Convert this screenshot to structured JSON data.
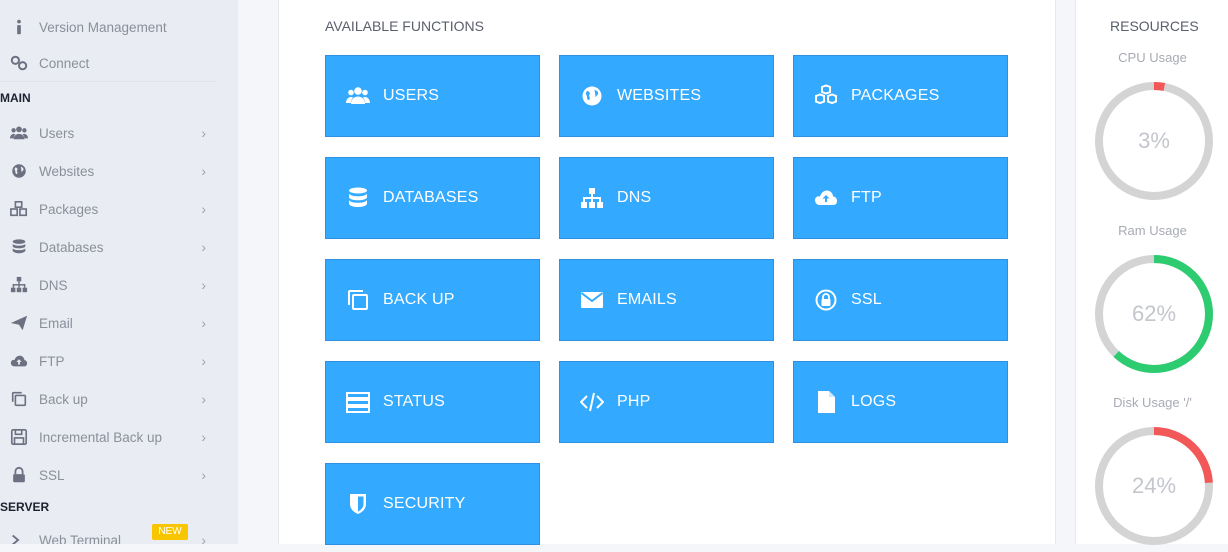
{
  "sidebar": {
    "top_items": [
      {
        "label": "Version Management",
        "icon": "info-icon"
      },
      {
        "label": "Connect",
        "icon": "link-icon"
      }
    ],
    "main_heading": "MAIN",
    "items": [
      {
        "label": "Users",
        "icon": "users-icon"
      },
      {
        "label": "Websites",
        "icon": "globe-icon"
      },
      {
        "label": "Packages",
        "icon": "cubes-icon"
      },
      {
        "label": "Databases",
        "icon": "database-icon"
      },
      {
        "label": "DNS",
        "icon": "sitemap-icon"
      },
      {
        "label": "Email",
        "icon": "paper-plane-icon"
      },
      {
        "label": "FTP",
        "icon": "cloud-upload-icon"
      },
      {
        "label": "Back up",
        "icon": "copy-icon"
      },
      {
        "label": "Incremental Back up",
        "icon": "save-icon"
      },
      {
        "label": "SSL",
        "icon": "lock-icon"
      }
    ],
    "server_heading": "SERVER",
    "server_items": [
      {
        "label": "Web Terminal",
        "icon": "terminal-icon",
        "badge": "NEW"
      }
    ],
    "chevron": "›"
  },
  "main": {
    "section_title": "AVAILABLE FUNCTIONS",
    "tiles": [
      {
        "label": "USERS",
        "icon": "users-icon"
      },
      {
        "label": "WEBSITES",
        "icon": "globe-icon"
      },
      {
        "label": "PACKAGES",
        "icon": "cubes-icon"
      },
      {
        "label": "DATABASES",
        "icon": "database-icon"
      },
      {
        "label": "DNS",
        "icon": "sitemap-icon"
      },
      {
        "label": "FTP",
        "icon": "cloud-upload-icon"
      },
      {
        "label": "BACK UP",
        "icon": "copy-icon"
      },
      {
        "label": "EMAILS",
        "icon": "envelope-icon"
      },
      {
        "label": "SSL",
        "icon": "lock-icon"
      },
      {
        "label": "STATUS",
        "icon": "server-icon"
      },
      {
        "label": "PHP",
        "icon": "code-icon"
      },
      {
        "label": "LOGS",
        "icon": "file-icon"
      },
      {
        "label": "SECURITY",
        "icon": "shield-icon"
      }
    ],
    "tile_color": "#33aaff"
  },
  "resources": {
    "title": "RESOURCES",
    "gauges": [
      {
        "label": "CPU Usage",
        "value": 3,
        "value_text": "3%",
        "color": "#f25858"
      },
      {
        "label": "Ram Usage",
        "value": 62,
        "value_text": "62%",
        "color": "#2ecc71"
      },
      {
        "label": "Disk Usage '/'",
        "value": 24,
        "value_text": "24%",
        "color": "#f25858"
      }
    ],
    "track_color": "#d4d4d4"
  }
}
